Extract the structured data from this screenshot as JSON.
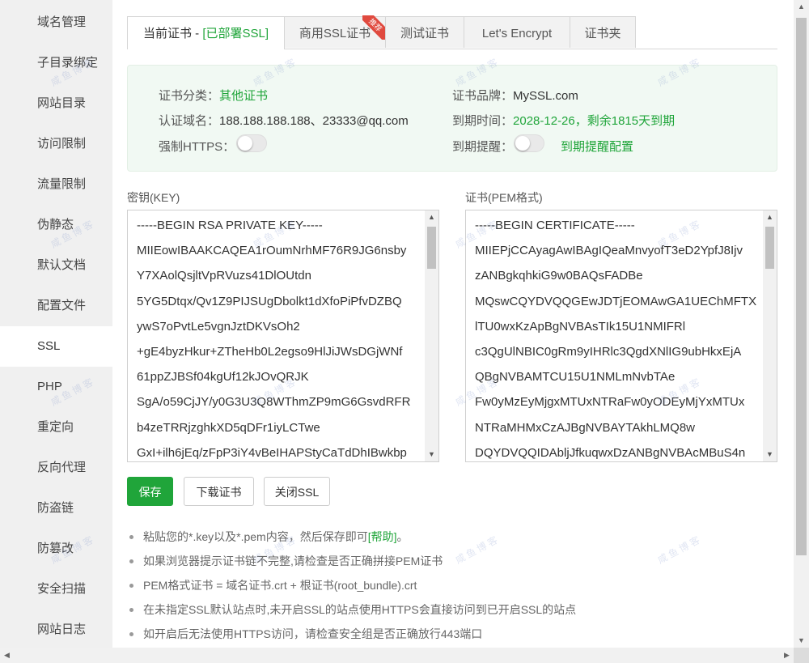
{
  "sidebar": {
    "items": [
      {
        "label": "域名管理"
      },
      {
        "label": "子目录绑定"
      },
      {
        "label": "网站目录"
      },
      {
        "label": "访问限制"
      },
      {
        "label": "流量限制"
      },
      {
        "label": "伪静态"
      },
      {
        "label": "默认文档"
      },
      {
        "label": "配置文件"
      },
      {
        "label": "SSL"
      },
      {
        "label": "PHP"
      },
      {
        "label": "重定向"
      },
      {
        "label": "反向代理"
      },
      {
        "label": "防盗链"
      },
      {
        "label": "防篡改"
      },
      {
        "label": "安全扫描"
      },
      {
        "label": "网站日志"
      }
    ],
    "active": "SSL"
  },
  "tabs": {
    "current_prefix": "当前证书 - ",
    "current_status": "[已部署SSL]",
    "commercial": "商用SSL证书",
    "commercial_badge": "推荐",
    "test": "测试证书",
    "letsencrypt": "Let's Encrypt",
    "folder": "证书夹"
  },
  "cert_info": {
    "category_label": "证书分类：",
    "category_value": "其他证书",
    "brand_label": "证书品牌：",
    "brand_value": "MySSL.com",
    "domain_label": "认证域名：",
    "domain_value": "188.188.188.188、23333@qq.com",
    "expire_label": "到期时间：",
    "expire_value": "2028-12-26，剩余1815天到期",
    "https_label": "强制HTTPS：",
    "remind_label": "到期提醒：",
    "remind_link": "到期提醒配置"
  },
  "key": {
    "label": "密钥(KEY)",
    "lines": [
      "-----BEGIN RSA PRIVATE KEY-----",
      "MIIEowIBAAKCAQEA1rOumNrhMF76R9JG6nsby",
      "Y7XAolQsjltVpRVuzs41DlOUtdn",
      "5YG5Dtqx/Qv1Z9PIJSUgDbolkt1dXfoPiPfvDZBQ",
      "ywS7oPvtLe5vgnJztDKVsOh2",
      "+gE4byzHkur+ZTheHb0L2egso9HlJiJWsDGjWNf",
      "61ppZJBSf04kgUf12kJOvQRJK",
      "SgA/o59CjJY/y0G3U3Q8WThmZP9mG6GsvdRFR",
      "b4zeTRRjzghkXD5qDFr1iyLCTwe",
      "GxI+ilh6jEq/zFpP3iY4vBeIHAPStyCaTdDhIBwkbp"
    ]
  },
  "cert": {
    "label": "证书(PEM格式)",
    "lines": [
      "-----BEGIN CERTIFICATE-----",
      "MIIEPjCCAyagAwIBAgIQeaMnvyofT3eD2YpfJ8Ijv",
      "zANBgkqhkiG9w0BAQsFADBe",
      "MQswCQYDVQQGEwJDTjEOMAwGA1UEChMFTX",
      "lTU0wxKzApBgNVBAsTIk15U1NMIFRl",
      "c3QgUlNBIC0gRm9yIHRlc3QgdXNlIG9ubHkxEjA",
      "QBgNVBAMTCU15U1NMLmNvbTAe",
      "Fw0yMzEyMjgxMTUxNTRaFw0yODEyMjYxMTUx",
      "NTRaMHMxCzAJBgNVBAYTAkhLMQ8w",
      "DQYDVQQIDAbljJfkuqwxDzANBgNVBAcMBuS4n"
    ]
  },
  "buttons": {
    "save": "保存",
    "download": "下载证书",
    "close_ssl": "关闭SSL"
  },
  "tips": {
    "tip1_text": "粘贴您的*.key以及*.pem内容，然后保存即可",
    "tip1_link": "[帮助]",
    "tip1_end": "。",
    "tip2": "如果浏览器提示证书链不完整,请检查是否正确拼接PEM证书",
    "tip3": "PEM格式证书 = 域名证书.crt + 根证书(root_bundle).crt",
    "tip4": "在未指定SSL默认站点时,未开启SSL的站点使用HTTPS会直接访问到已开启SSL的站点",
    "tip5": "如开启后无法使用HTTPS访问，请检查安全组是否正确放行443端口"
  },
  "watermark": "咸鱼博客",
  "colors": {
    "accent": "#20a53a",
    "badge": "#e04a3f",
    "info_bg": "#f1f9f3"
  },
  "toggles": {
    "force_https": false,
    "expiry_remind": false
  }
}
